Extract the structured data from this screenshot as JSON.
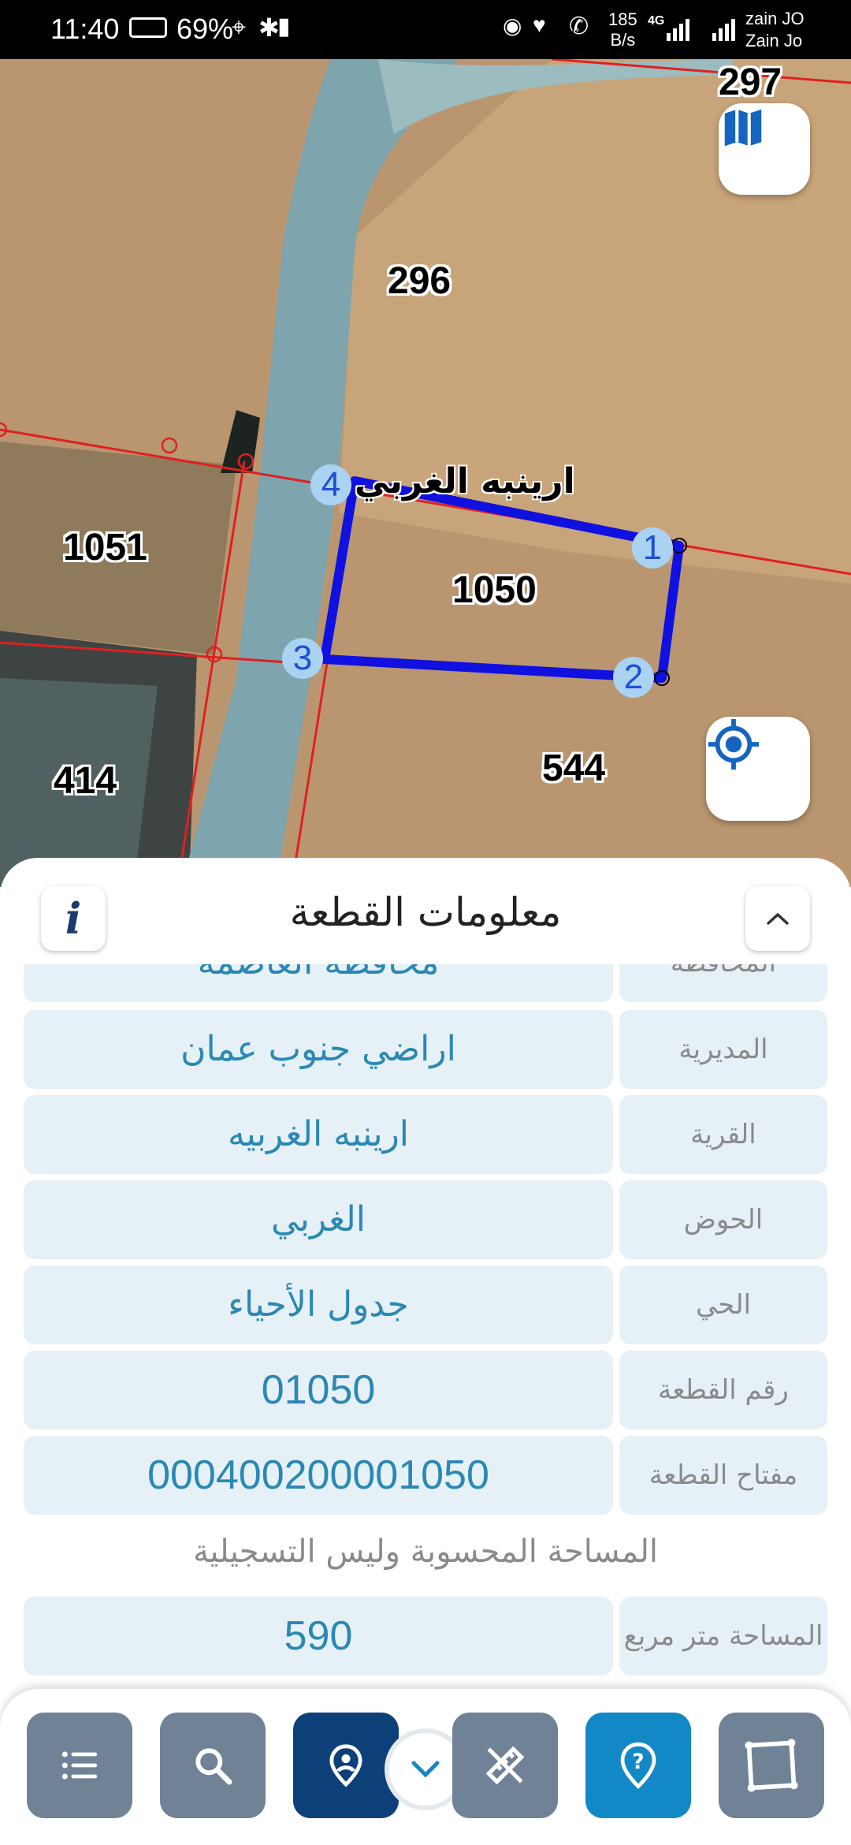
{
  "status_bar": {
    "time": "11:40",
    "battery": "69%",
    "speed_value": "185",
    "speed_unit": "B/s",
    "network": "4G",
    "carrier_1": "zain JO",
    "carrier_2": "Zain Jo"
  },
  "map": {
    "parcels": [
      {
        "label": "297"
      },
      {
        "label": "296"
      },
      {
        "label": "1051"
      },
      {
        "label": "1050"
      },
      {
        "label": "414"
      },
      {
        "label": "544"
      }
    ],
    "vertices": [
      "1",
      "2",
      "3",
      "4"
    ],
    "village_label": "ارينبه الغربي",
    "boundary_color": "#1010e0",
    "line_color": "#e02020"
  },
  "panel": {
    "title": "معلومات القطعة",
    "rows": [
      {
        "label": "المحافظة",
        "value": "محافظة العاصمة"
      },
      {
        "label": "المديرية",
        "value": "اراضي جنوب عمان"
      },
      {
        "label": "القرية",
        "value": "ارينبه الغربيه"
      },
      {
        "label": "الحوض",
        "value": "الغربي"
      },
      {
        "label": "الحي",
        "value": "جدول الأحياء"
      },
      {
        "label": "رقم القطعة",
        "value": "01050"
      },
      {
        "label": "مفتاح القطعة",
        "value": "000400200001050"
      }
    ],
    "area_note": "المساحة المحسوبة وليس التسجيلية",
    "area_row": {
      "label": "المساحة متر مربع",
      "value": "590"
    }
  },
  "toolbar": {
    "buttons": [
      "list-icon",
      "search-icon",
      "location-pin-icon",
      "measure-icon",
      "help-icon",
      "polygon-icon"
    ]
  }
}
